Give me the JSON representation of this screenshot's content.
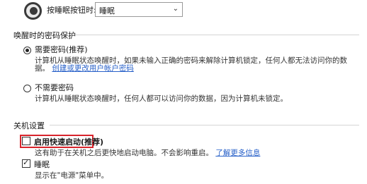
{
  "sleep_button": {
    "label": "按睡眠按钮时:",
    "selected_value": "睡眠",
    "icon": "moon-icon"
  },
  "wake_password": {
    "title": "唤醒时的密码保护",
    "option_require": {
      "label": "需要密码(推荐)",
      "desc_line1": "计算机从睡眠状态唤醒时，如果未输入正确的密码来解除计算机锁定，任何人都无法访问你的数",
      "desc_line2": "据。",
      "link": "创建或更改用户帐户密码"
    },
    "option_none": {
      "label": "不需要密码",
      "desc": "计算机从睡眠状态唤醒时，任何人都可以访问你的数据，因为计算机未锁定。"
    }
  },
  "shutdown_settings": {
    "title": "关机设置",
    "fast_startup": {
      "label": "启用快速启动(推荐)",
      "desc": "这有助于在关机之后更快地启动电脑。不会影响重启。",
      "link": "了解更多信息"
    },
    "sleep": {
      "label": "睡眠",
      "desc": "显示在\"电源\"菜单中。"
    }
  },
  "colors": {
    "link": "#2a62c9",
    "highlight": "#d8242c"
  }
}
